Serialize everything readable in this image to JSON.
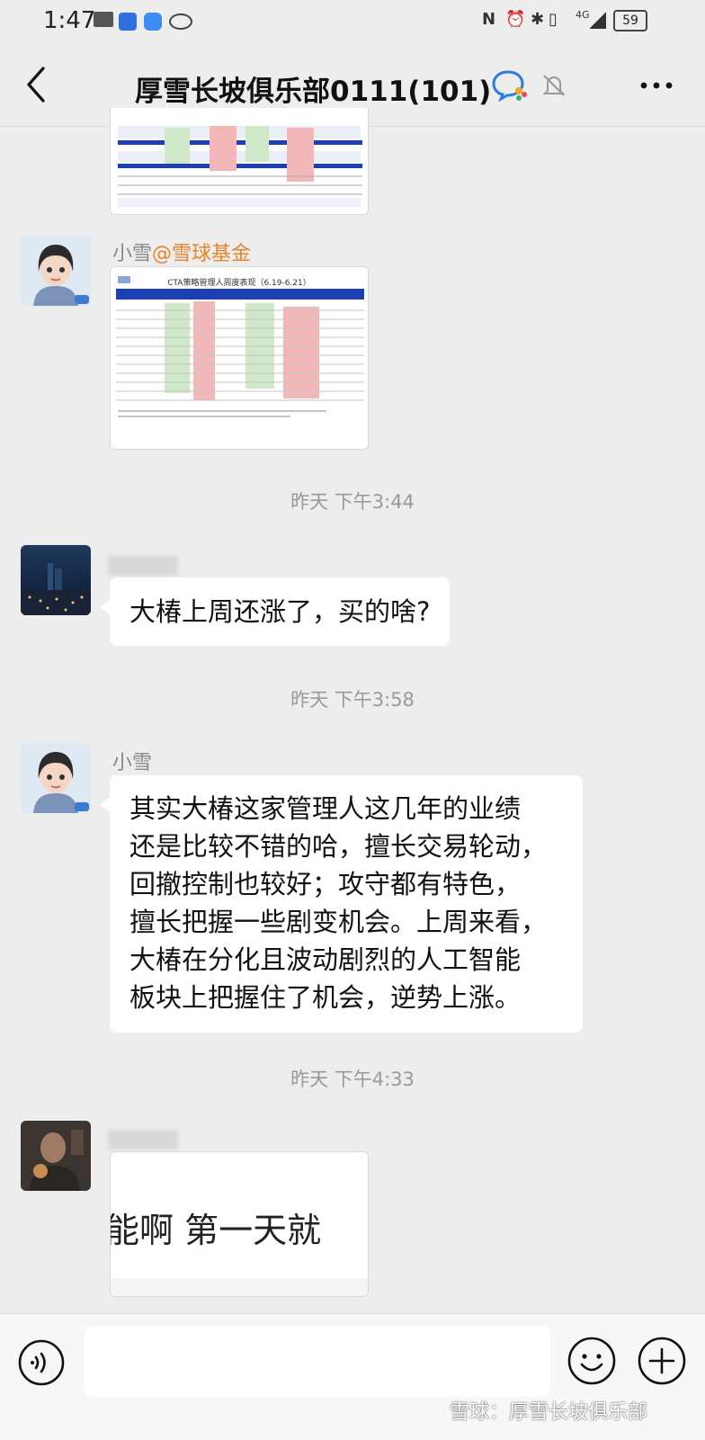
{
  "status_bar": {
    "time": "1:47",
    "network": "4G",
    "battery": "59"
  },
  "header": {
    "title": "厚雪长坡俱乐部0111(101)"
  },
  "messages": {
    "m2": {
      "sender": "小雪",
      "mention": "@雪球基金",
      "image_title": "CTA策略管理人周度表现（6.19-6.21）"
    },
    "ts1": "昨天 下午3:44",
    "m3": {
      "text": "大椿上周还涨了，买的啥?"
    },
    "ts2": "昨天 下午3:58",
    "m4": {
      "sender": "小雪",
      "lines": [
        "其实大椿这家管理人这几年的业绩",
        "还是比较不错的哈，擅长交易轮动，",
        "回撤控制也较好；攻守都有特色，",
        "擅长把握一些剧变机会。上周来看，",
        "大椿在分化且波动剧烈的人工智能",
        "板块上把握住了机会，逆势上涨。"
      ]
    },
    "ts3": "昨天 下午4:33",
    "m5": {
      "image_text": "能啊 第一天就"
    }
  },
  "watermark": "雪球：厚雪长坡俱乐部",
  "icons": {
    "back": "chevron-left-icon",
    "wecom": "wecom-chat-icon",
    "mute": "bell-off-icon",
    "more": "more-dots-icon",
    "voice": "voice-icon",
    "emoji": "emoji-icon",
    "plus": "plus-icon"
  },
  "colors": {
    "background": "#ededed",
    "bubble": "#ffffff",
    "mention": "#e8832b",
    "table_header": "#1d3fb5"
  }
}
